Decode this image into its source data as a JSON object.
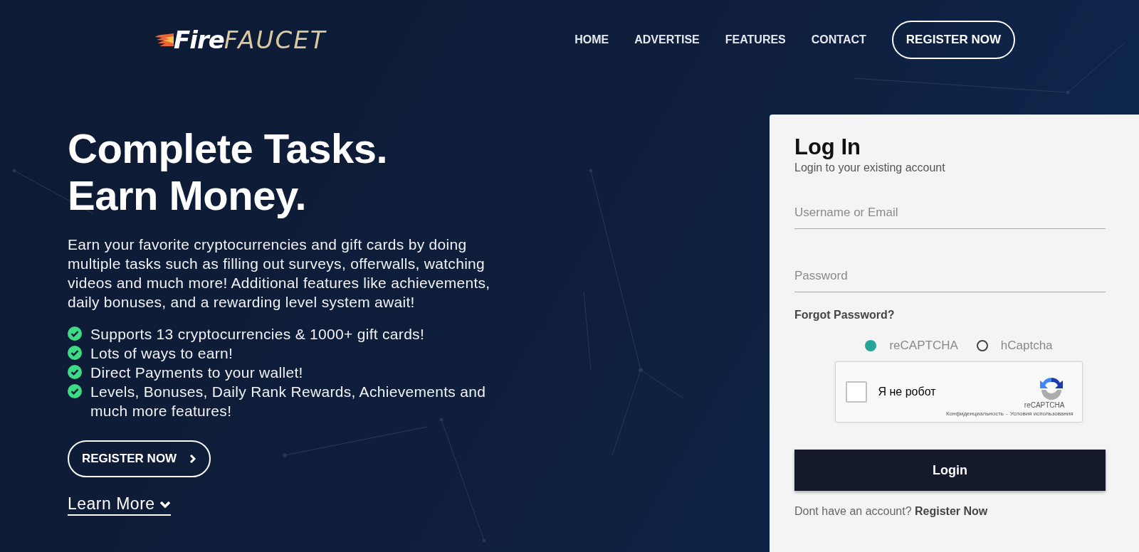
{
  "logo": {
    "first": "Fire",
    "second": "FAUCET"
  },
  "nav": {
    "links": [
      "HOME",
      "ADVERTISE",
      "FEATURES",
      "CONTACT"
    ],
    "cta": "REGISTER NOW"
  },
  "hero": {
    "title": "Complete Tasks. Earn Money.",
    "text": "Earn your favorite cryptocurrencies and gift cards by doing multiple tasks such as filling out surveys, offerwalls, watching videos and much more! Additional features like achievements, daily bonuses, and a rewarding level system await!",
    "features": [
      "Supports 13 cryptocurrencies & 1000+ gift cards!",
      "Lots of ways to earn!",
      "Direct Payments to your wallet!",
      "Levels, Bonuses, Daily Rank Rewards, Achievements and much more features!"
    ],
    "register_button": "REGISTER NOW",
    "learn_more": "Learn More"
  },
  "login": {
    "title": "Log In",
    "subtitle": "Login to your existing account",
    "fields": [
      {
        "placeholder": "Username or Email"
      },
      {
        "placeholder": "Password"
      }
    ],
    "forgot": "Forgot Password?",
    "captcha_options": [
      {
        "label": "reCAPTCHA",
        "selected": true
      },
      {
        "label": "hCaptcha",
        "selected": false
      }
    ],
    "recaptcha": {
      "checked": false,
      "label": "Я не робот",
      "brand": "reCAPTCHA",
      "privacy": "Конфиденциальность",
      "separator": "-",
      "terms": "Условия использования"
    },
    "button": "Login",
    "footer_text": "Dont have an account?",
    "footer_link": "Register Now"
  }
}
